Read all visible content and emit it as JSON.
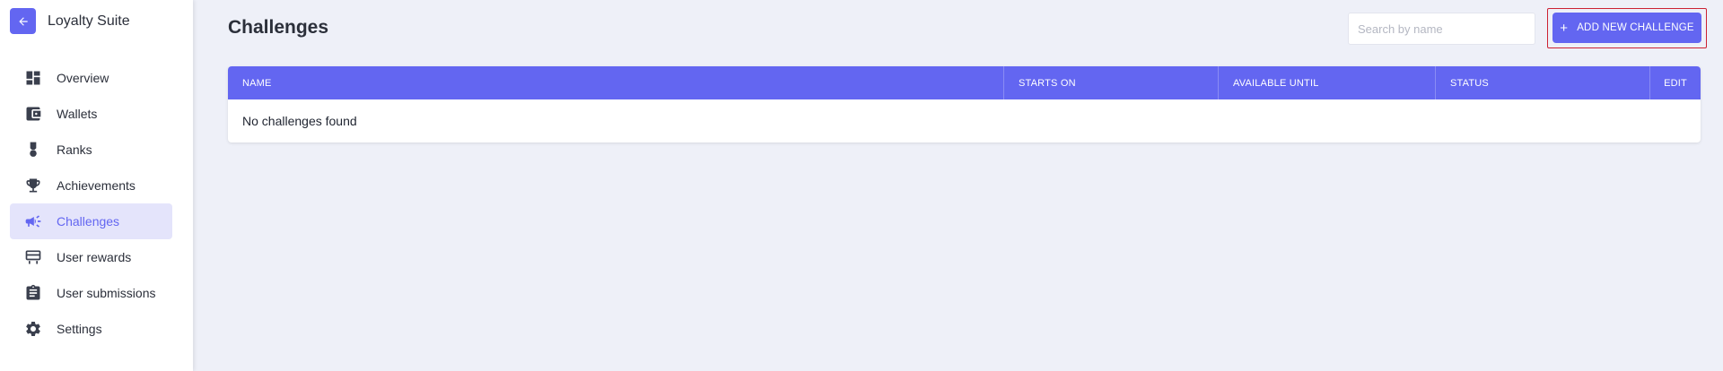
{
  "app": {
    "title": "Loyalty Suite",
    "accent_color": "#6366f1"
  },
  "sidebar": {
    "back_icon": "arrow-left-icon",
    "items": [
      {
        "label": "Overview",
        "icon": "dashboard-icon",
        "active": false
      },
      {
        "label": "Wallets",
        "icon": "wallet-icon",
        "active": false
      },
      {
        "label": "Ranks",
        "icon": "rank-medal-icon",
        "active": false
      },
      {
        "label": "Achievements",
        "icon": "trophy-icon",
        "active": false
      },
      {
        "label": "Challenges",
        "icon": "megaphone-icon",
        "active": true
      },
      {
        "label": "User rewards",
        "icon": "reward-card-icon",
        "active": false
      },
      {
        "label": "User submissions",
        "icon": "clipboard-icon",
        "active": false
      },
      {
        "label": "Settings",
        "icon": "gear-icon",
        "active": false
      }
    ]
  },
  "main": {
    "title": "Challenges",
    "search": {
      "placeholder": "Search by name",
      "value": ""
    },
    "add_button": {
      "label": "ADD NEW CHALLENGE",
      "icon": "plus-icon"
    },
    "table": {
      "columns": [
        "NAME",
        "STARTS ON",
        "AVAILABLE UNTIL",
        "STATUS",
        "EDIT"
      ],
      "empty_message": "No challenges found"
    }
  }
}
